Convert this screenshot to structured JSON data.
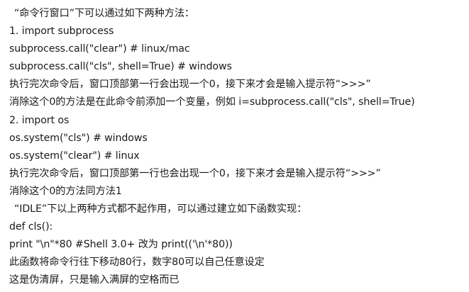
{
  "document": {
    "lines": [
      "“命令行窗口”下可以通过如下两种方法：",
      "1. import subprocess",
      "subprocess.call(\"clear\") # linux/mac",
      "subprocess.call(\"cls\", shell=True) # windows",
      "执行完次命令后，窗口顶部第一行会出现一个0，接下来才会是输入提示符“>>>”",
      "消除这个0的方法是在此命令前添加一个变量，例如 i=subprocess.call(\"cls\", shell=True)",
      "2. import os",
      "os.system(\"cls\") # windows",
      "os.system(\"clear\") # linux",
      "执行完次命令后，窗口顶部第一行也会出现一个0，接下来才会是输入提示符“>>>”",
      "消除这个0的方法同方法1",
      "“IDLE”下以上两种方式都不起作用，可以通过建立如下函数实现：",
      "def cls():",
      "print \"\\n\"*80 #Shell 3.0+ 改为 print(('\\n'*80))",
      "此函数将命令行往下移动80行，数字80可以自己任意设定",
      "这是伪清屏，只是输入满屏的空格而已"
    ]
  }
}
